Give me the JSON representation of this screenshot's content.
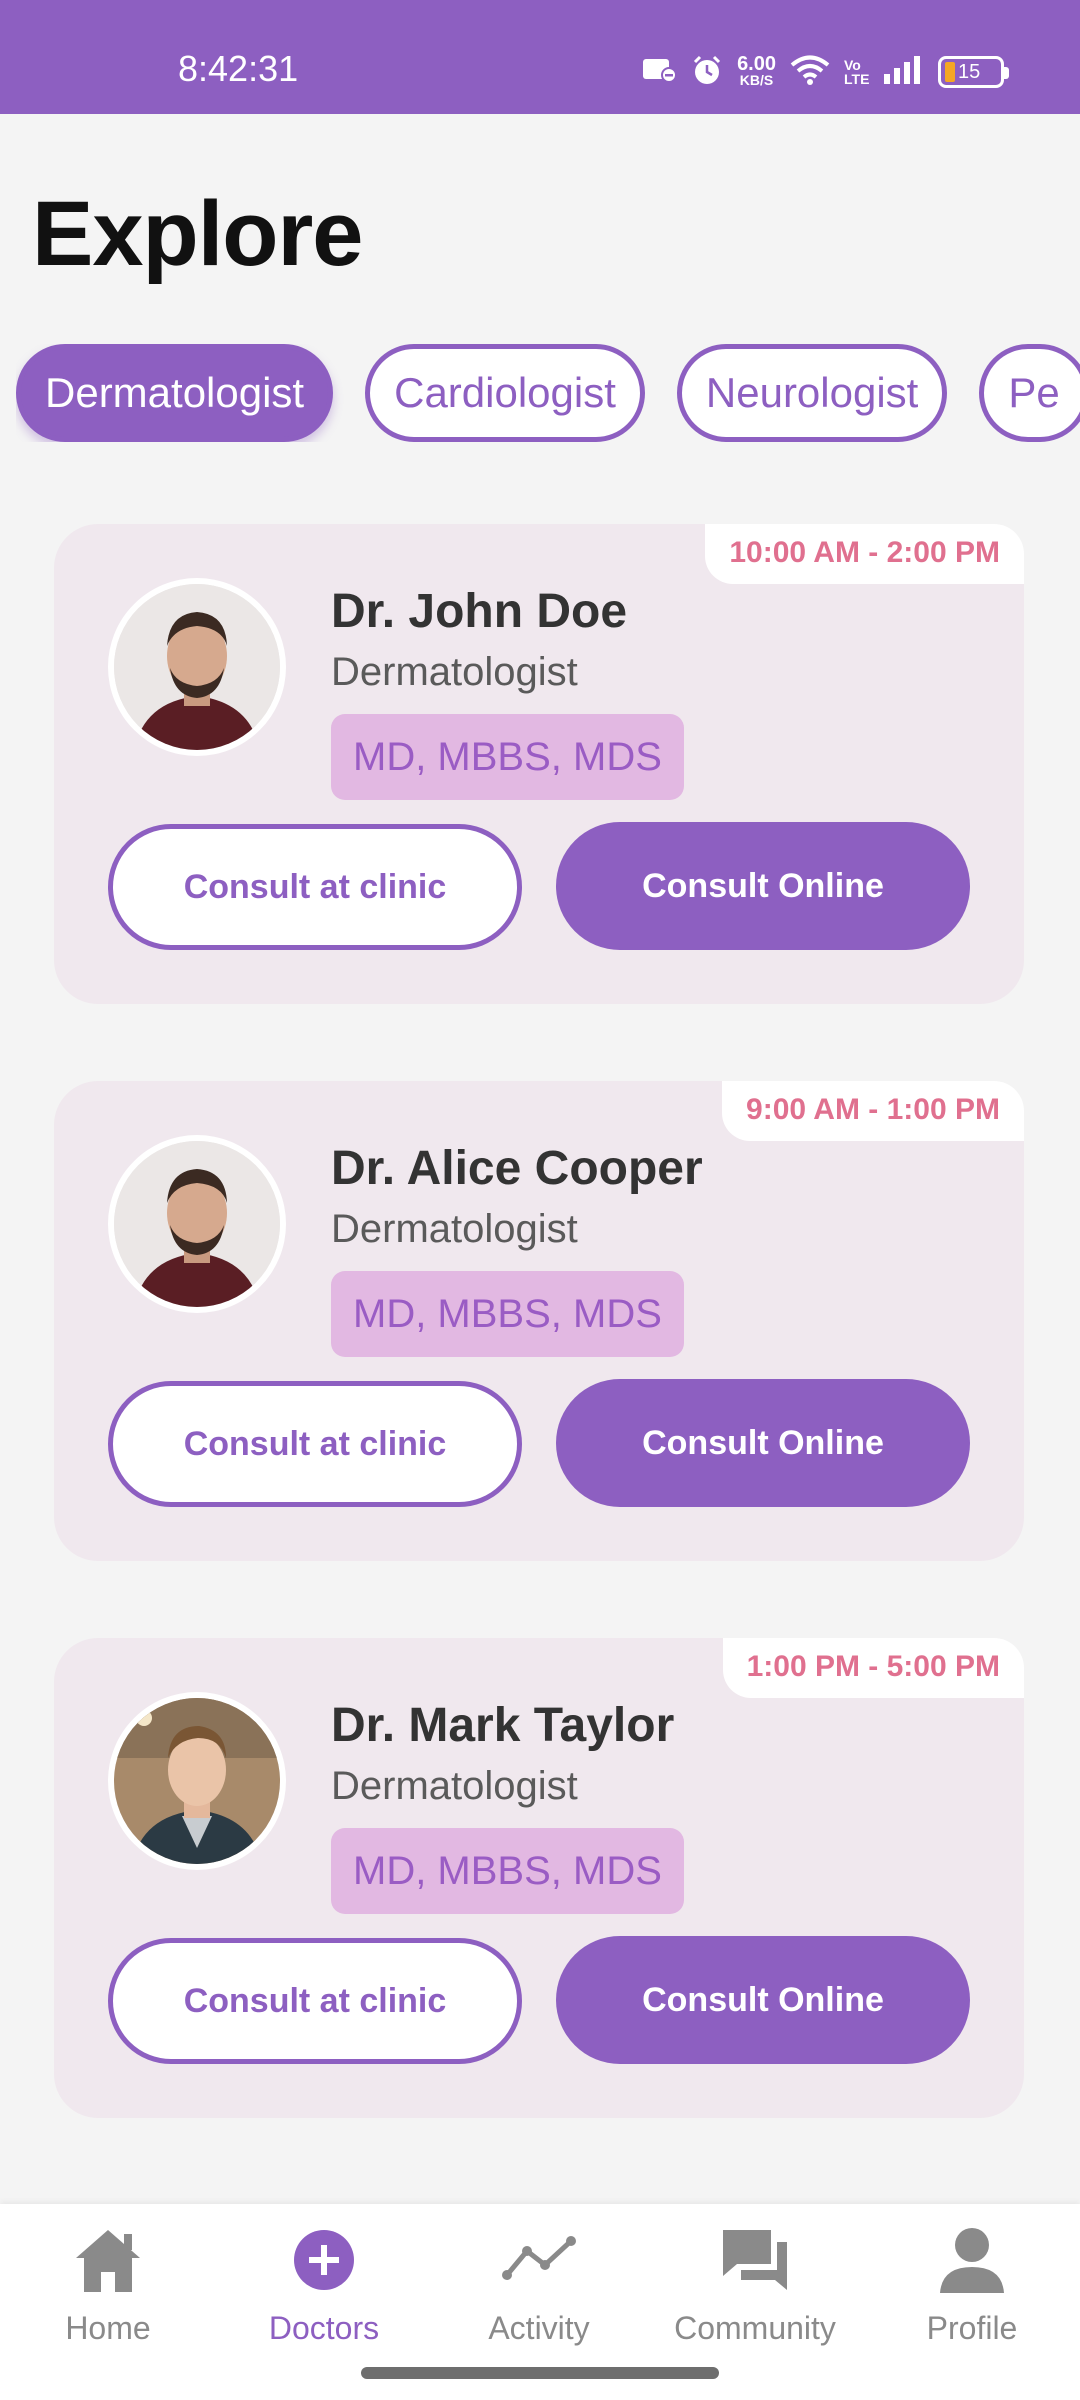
{
  "status_bar": {
    "time": "8:42:31",
    "net_speed_value": "6.00",
    "net_speed_unit": "KB/S",
    "network_label": "Vo LTE",
    "battery": "15"
  },
  "title": "Explore",
  "categories": [
    "Dermatologist",
    "Cardiologist",
    "Neurologist",
    "Pe"
  ],
  "active_category": "Dermatologist",
  "doctors": [
    {
      "name": "Dr. John Doe",
      "specialty": "Dermatologist",
      "degrees": "MD, MBBS, MDS",
      "hours": "10:00 AM - 2:00 PM",
      "clinic_label": "Consult at clinic",
      "online_label": "Consult Online"
    },
    {
      "name": "Dr. Alice Cooper",
      "specialty": "Dermatologist",
      "degrees": "MD, MBBS, MDS",
      "hours": "9:00 AM - 1:00 PM",
      "clinic_label": "Consult at clinic",
      "online_label": "Consult Online"
    },
    {
      "name": "Dr. Mark Taylor",
      "specialty": "Dermatologist",
      "degrees": "MD, MBBS, MDS",
      "hours": "1:00 PM - 5:00 PM",
      "clinic_label": "Consult at clinic",
      "online_label": "Consult Online"
    }
  ],
  "bottom_nav": [
    {
      "label": "Home",
      "icon": "home-icon"
    },
    {
      "label": "Doctors",
      "icon": "plus-circle-icon"
    },
    {
      "label": "Activity",
      "icon": "activity-chart-icon"
    },
    {
      "label": "Community",
      "icon": "chat-bubbles-icon"
    },
    {
      "label": "Profile",
      "icon": "person-icon"
    }
  ],
  "active_nav": "Doctors",
  "colors": {
    "primary": "#8d5fc1",
    "card_bg": "#f0e8ee",
    "badge_text": "#e0708f",
    "degree_bg": "#e2b8e2"
  }
}
